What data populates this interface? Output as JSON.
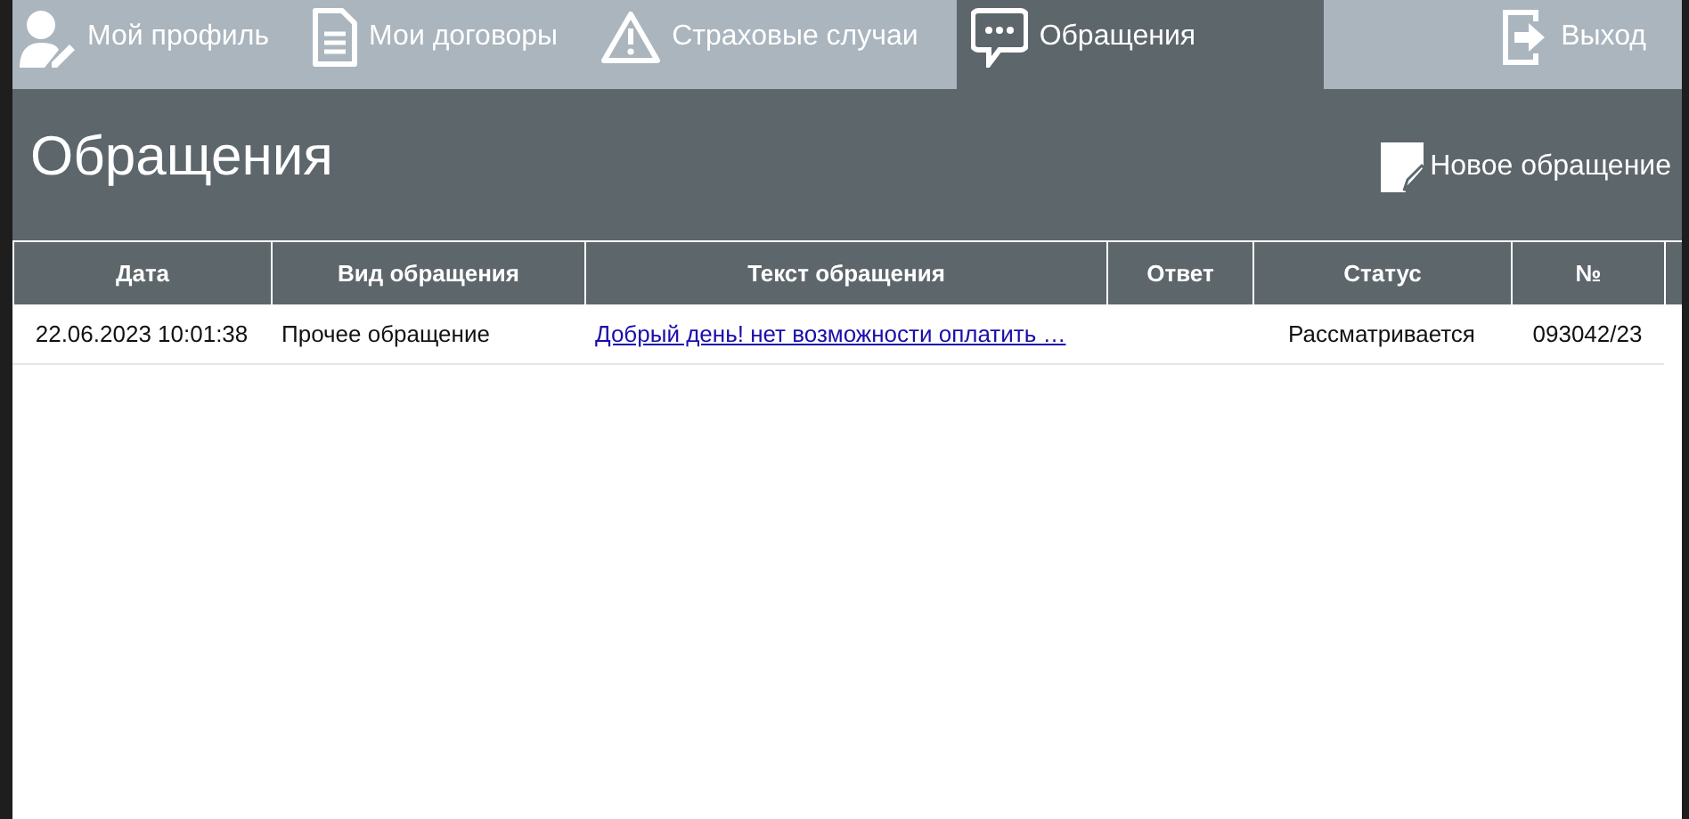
{
  "nav": {
    "tabs": [
      {
        "kind": "profile",
        "label": "Мой профиль",
        "selected": false
      },
      {
        "kind": "contracts",
        "label": "Мои договоры",
        "selected": false
      },
      {
        "kind": "claims",
        "label": "Страховые случаи",
        "selected": false
      },
      {
        "kind": "requests",
        "label": "Обращения",
        "selected": true
      }
    ],
    "logout": "Выход"
  },
  "header": {
    "title": "Обращения",
    "new_button": "Новое обращение"
  },
  "table": {
    "columns": [
      "Дата",
      "Вид обращения",
      "Текст обращения",
      "Ответ",
      "Статус",
      "№"
    ],
    "rows": [
      {
        "date": "22.06.2023 10:01:38",
        "type": "Прочее обращение",
        "text": "Добрый день! нет возможности оплатить …",
        "status": "Рассматривается",
        "number": "093042/23"
      }
    ]
  }
}
